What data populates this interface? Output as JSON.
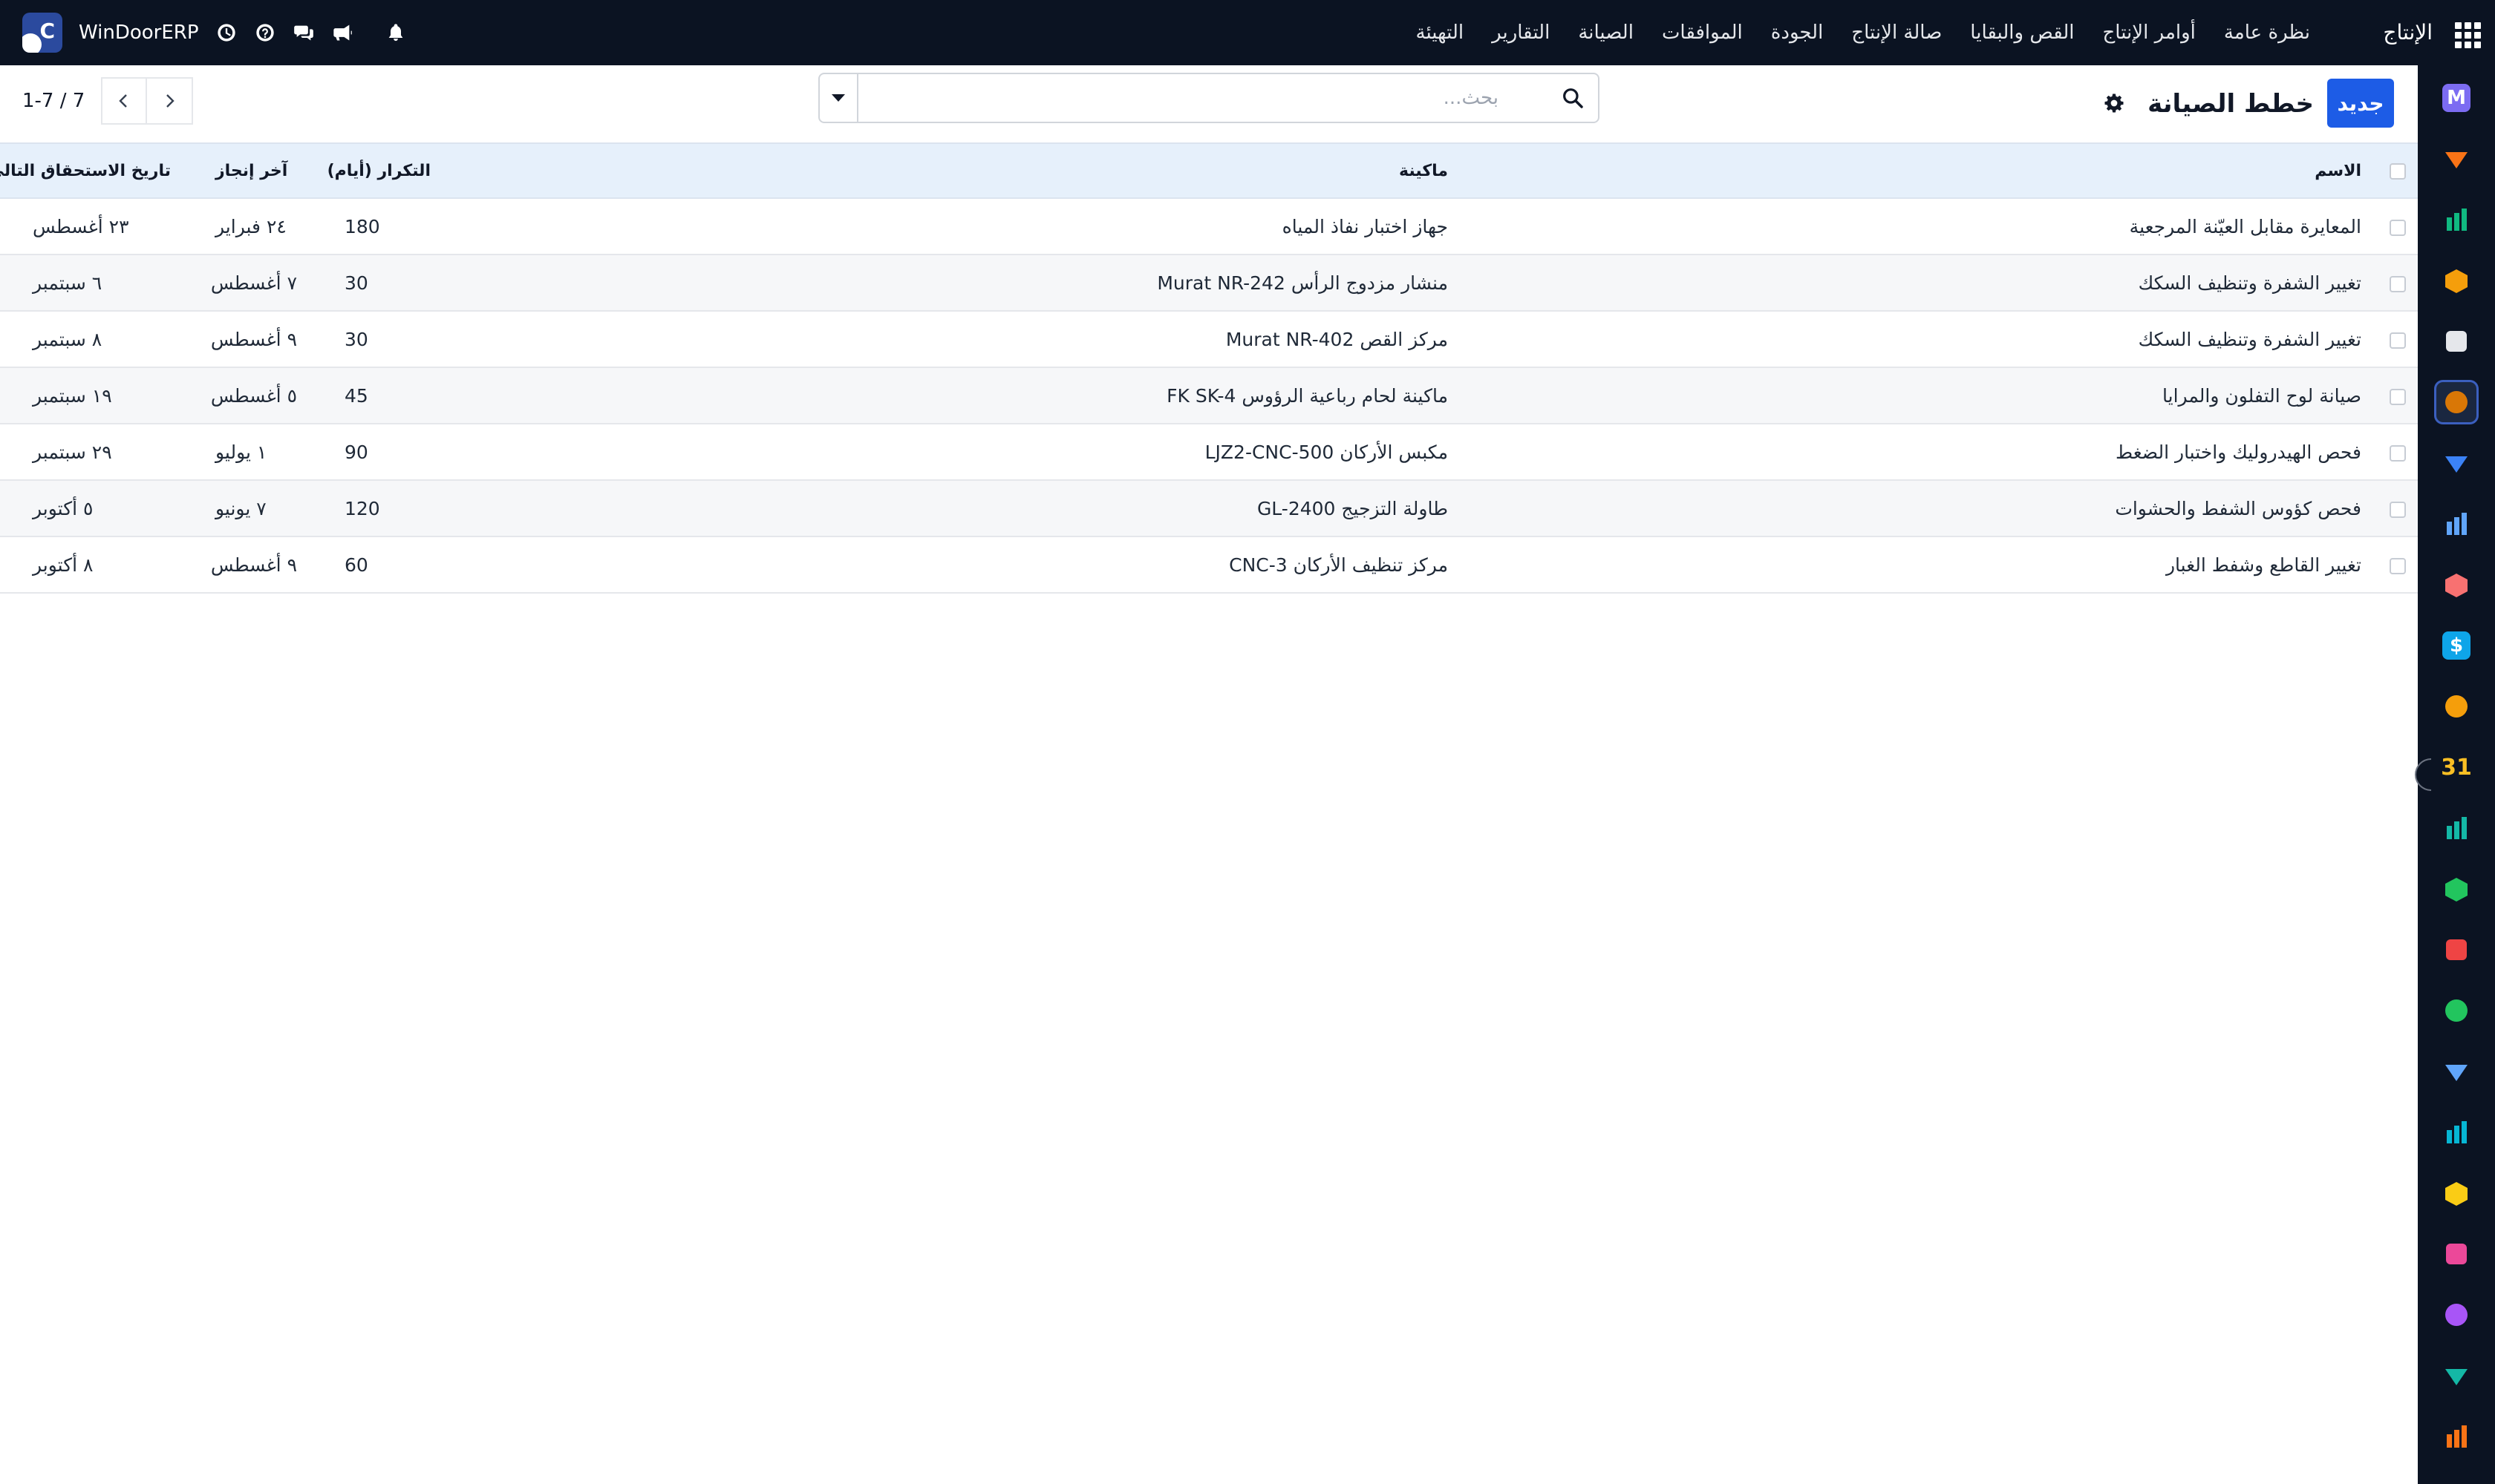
{
  "topbar": {
    "app_title": "الإنتاج",
    "menu": [
      "نظرة عامة",
      "أوامر الإنتاج",
      "القص والبقايا",
      "صالة الإنتاج",
      "الجودة",
      "الموافقات",
      "الصيانة",
      "التقارير",
      "التهيئة"
    ],
    "brand_name": "WinDoorERP",
    "brand_letter": "C",
    "icons": [
      "clock-icon",
      "help-icon",
      "chat-icon",
      "megaphone-icon",
      "bell-icon"
    ]
  },
  "control": {
    "new_label": "جديد",
    "title": "خطط الصيانة",
    "search_placeholder": "بحث...",
    "pager_value": "1-7 / 7"
  },
  "table": {
    "headers": {
      "name": "الاسم",
      "machine": "ماكينة",
      "frequency": "التكرار (أيام)",
      "last_done": "آخر إنجاز",
      "next_due": "تاريخ الاستحقاق التالي"
    },
    "rows": [
      {
        "name": "المعايرة مقابل العيّنة المرجعية",
        "machine": "جهاز اختبار نفاذ المياه",
        "frequency": "180",
        "last_done": "٢٤ فبراير",
        "next_due": "٢٣ أغسطس"
      },
      {
        "name": "تغيير الشفرة وتنظيف السكك",
        "machine": "منشار مزدوج الرأس Murat NR-242",
        "frequency": "30",
        "last_done": "٧ أغسطس",
        "next_due": "٦ سبتمبر"
      },
      {
        "name": "تغيير الشفرة وتنظيف السكك",
        "machine": "مركز القص Murat NR-402",
        "frequency": "30",
        "last_done": "٩ أغسطس",
        "next_due": "٨ سبتمبر"
      },
      {
        "name": "صيانة لوح التفلون والمرايا",
        "machine": "ماكينة لحام رباعية الرؤوس FK SK-4",
        "frequency": "45",
        "last_done": "٥ أغسطس",
        "next_due": "١٩ سبتمبر"
      },
      {
        "name": "فحص الهيدروليك واختبار الضغط",
        "machine": "مكبس الأركان LJZ2-CNC-500",
        "frequency": "90",
        "last_done": "١ يوليو",
        "next_due": "٢٩ سبتمبر"
      },
      {
        "name": "فحص كؤوس الشفط والحشوات",
        "machine": "طاولة التزجيج GL-2400",
        "frequency": "120",
        "last_done": "٧ يونيو",
        "next_due": "٥ أكتوبر"
      },
      {
        "name": "تغيير القاطع وشفط الغبار",
        "machine": "مركز تنظيف الأركان CNC-3",
        "frequency": "60",
        "last_done": "٩ أغسطس",
        "next_due": "٨ أكتوبر"
      }
    ]
  },
  "rail": {
    "apps": [
      {
        "icon": "mail-app-icon",
        "color": "#7c6cf2",
        "glyph": "M"
      },
      {
        "icon": "discuss-app-icon",
        "color": "#f97316",
        "glyph": ""
      },
      {
        "icon": "tasks-app-icon",
        "color": "#10b981",
        "glyph": ""
      },
      {
        "icon": "reports-app-icon",
        "color": "#f59e0b",
        "glyph": ""
      },
      {
        "icon": "inventory-app-icon",
        "color": "#e5e7eb",
        "glyph": ""
      },
      {
        "icon": "production-app-icon",
        "color": "#d97706",
        "glyph": ""
      },
      {
        "icon": "quality-app-icon",
        "color": "#3b82f6",
        "glyph": ""
      },
      {
        "icon": "knowledge-app-icon",
        "color": "#60a5fa",
        "glyph": ""
      },
      {
        "icon": "products-app-icon",
        "color": "#f87171",
        "glyph": ""
      },
      {
        "icon": "invoicing-app-icon",
        "color": "#0ea5e9",
        "glyph": "$"
      },
      {
        "icon": "employees-app-icon",
        "color": "#f59e0b",
        "glyph": ""
      },
      {
        "icon": "calendar-app-icon",
        "color": "#fbbf24",
        "glyph": "31"
      },
      {
        "icon": "sign-app-icon",
        "color": "#14b8a6",
        "glyph": ""
      },
      {
        "icon": "contacts-app-icon",
        "color": "#22c55e",
        "glyph": ""
      },
      {
        "icon": "dashboards-app-icon",
        "color": "#ef4444",
        "glyph": ""
      },
      {
        "icon": "whatsapp-app-icon",
        "color": "#22c55e",
        "glyph": ""
      },
      {
        "icon": "timesheet-app-icon",
        "color": "#60a5fa",
        "glyph": ""
      },
      {
        "icon": "website-app-icon",
        "color": "#06b6d4",
        "glyph": ""
      },
      {
        "icon": "email-marketing-app-icon",
        "color": "#facc15",
        "glyph": ""
      },
      {
        "icon": "planning-app-icon",
        "color": "#ec4899",
        "glyph": ""
      },
      {
        "icon": "apps-store-icon",
        "color": "#a855f7",
        "glyph": ""
      },
      {
        "icon": "spreadsheet-app-icon",
        "color": "#14b8a6",
        "glyph": ""
      },
      {
        "icon": "settings-app-icon",
        "color": "#f97316",
        "glyph": ""
      }
    ]
  }
}
